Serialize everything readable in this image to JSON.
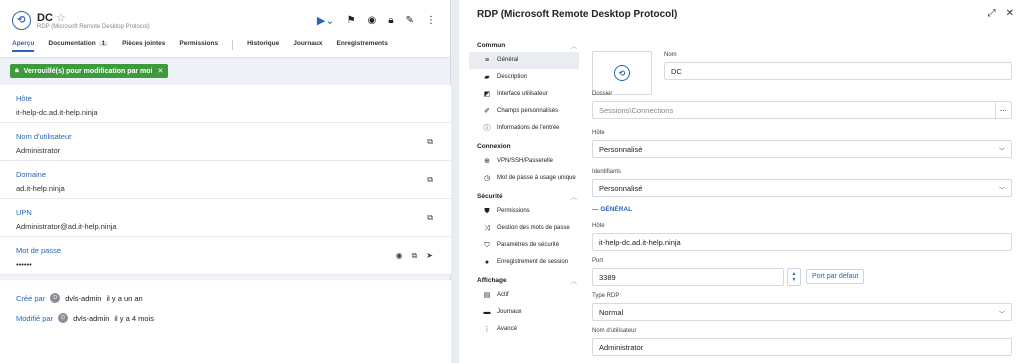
{
  "left": {
    "title": "DC",
    "subtitle": "RDP (Microsoft Remote Desktop Protocol)",
    "tabs": [
      {
        "label": "Aperçu"
      },
      {
        "label": "Documentation",
        "badge": "1"
      },
      {
        "label": "Pièces jointes"
      },
      {
        "label": "Permissions"
      },
      {
        "label": "Historique"
      },
      {
        "label": "Journaux"
      },
      {
        "label": "Enregistrements"
      }
    ],
    "lock_banner": "Verrouillé(s) pour modification par moi",
    "fields": [
      {
        "label": "Hôte",
        "value": "it-help-dc.ad.it-help.ninja"
      },
      {
        "label": "Nom d'utilisateur",
        "value": "Administrator"
      },
      {
        "label": "Domaine",
        "value": "ad.it-help.ninja"
      },
      {
        "label": "UPN",
        "value": "Administrator@ad.it-help.ninja"
      },
      {
        "label": "Mot de passe",
        "value": "••••••"
      }
    ],
    "meta": [
      {
        "label": "Créé par",
        "avatar": "D",
        "user": "dvls-admin",
        "when": "il y a un an"
      },
      {
        "label": "Modifié par",
        "avatar": "D",
        "user": "dvls-admin",
        "when": "il y a 4 mois"
      }
    ]
  },
  "right": {
    "title": "RDP (Microsoft Remote Desktop Protocol)",
    "nav": {
      "commun": {
        "label": "Commun",
        "items": [
          "Général",
          "Description",
          "Interface utilisateur",
          "Champs personnalisés",
          "Informations de l'entrée"
        ]
      },
      "connexion": {
        "label": "Connexion",
        "items": [
          "VPN/SSH/Passerelle",
          "Mot de passe à usage unique"
        ]
      },
      "securite": {
        "label": "Sécurité",
        "items": [
          "Permissions",
          "Gestion des mots de passe",
          "Paramètres de sécurité",
          "Enregistrement de session"
        ]
      },
      "affichage": {
        "label": "Affichage",
        "items": [
          "Actif",
          "Journaux",
          "Avancé"
        ]
      }
    },
    "form": {
      "nom_label": "Nom",
      "nom_value": "DC",
      "dossier_label": "Dossier",
      "dossier_placeholder": "Sessions\\Connections",
      "hote_label": "Hôte",
      "hote_value": "Personnalisé",
      "identifiants_label": "Identifiants",
      "identifiants_value": "Personnalisé",
      "section_general": "GÉNÉRAL",
      "hote2_label": "Hôte",
      "hote2_value": "it-help-dc.ad.it-help.ninja",
      "port_label": "Port",
      "port_value": "3389",
      "port_default_button": "Port par défaut",
      "type_label": "Type RDP",
      "type_value": "Normal",
      "user_label": "Nom d'utilisateur",
      "user_value": "Administrator"
    }
  }
}
